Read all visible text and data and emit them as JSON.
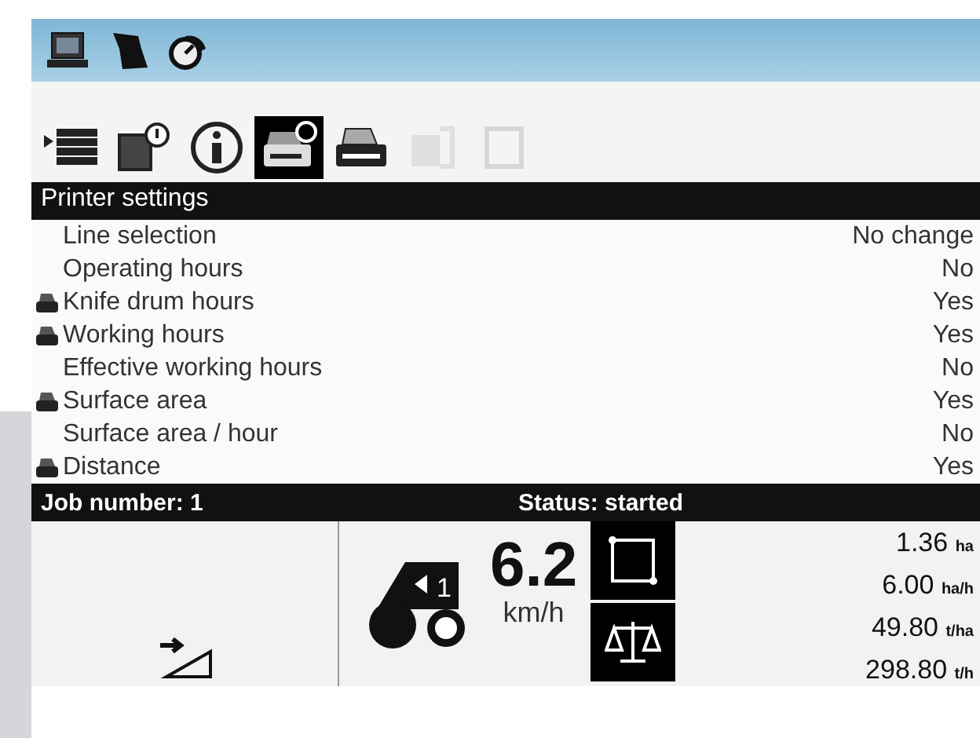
{
  "top_bar": {
    "icons": [
      {
        "kind": "laptop"
      },
      {
        "kind": "field"
      },
      {
        "kind": "gauge"
      }
    ]
  },
  "toolbar": [
    {
      "kind": "list",
      "selected": false,
      "disabled": false
    },
    {
      "kind": "note",
      "selected": false,
      "disabled": false
    },
    {
      "kind": "info",
      "selected": false,
      "disabled": false
    },
    {
      "kind": "printer-settings",
      "selected": true,
      "disabled": false
    },
    {
      "kind": "printer",
      "selected": false,
      "disabled": false
    },
    {
      "kind": "doc",
      "selected": false,
      "disabled": true
    },
    {
      "kind": "page",
      "selected": false,
      "disabled": true
    }
  ],
  "section_title": "Printer settings",
  "settings": [
    {
      "label": "Line selection",
      "value": "No change",
      "printed": false
    },
    {
      "label": "Operating hours",
      "value": "No",
      "printed": false
    },
    {
      "label": "Knife drum hours",
      "value": "Yes",
      "printed": true
    },
    {
      "label": "Working hours",
      "value": "Yes",
      "printed": true
    },
    {
      "label": "Effective working hours",
      "value": "No",
      "printed": false
    },
    {
      "label": "Surface area",
      "value": "Yes",
      "printed": true
    },
    {
      "label": "Surface area / hour",
      "value": "No",
      "printed": false
    },
    {
      "label": "Distance",
      "value": "Yes",
      "printed": true
    }
  ],
  "status_bar": {
    "job": "Job number: 1",
    "status": "Status: started"
  },
  "dashboard": {
    "gear": "1",
    "speed": "6.2",
    "speed_unit": "km/h",
    "readings": [
      {
        "value": "1.36",
        "unit": "ha"
      },
      {
        "value": "6.00",
        "unit": "ha/h"
      },
      {
        "value": "49.80",
        "unit": "t/ha"
      },
      {
        "value": "298.80",
        "unit": "t/h"
      }
    ]
  }
}
